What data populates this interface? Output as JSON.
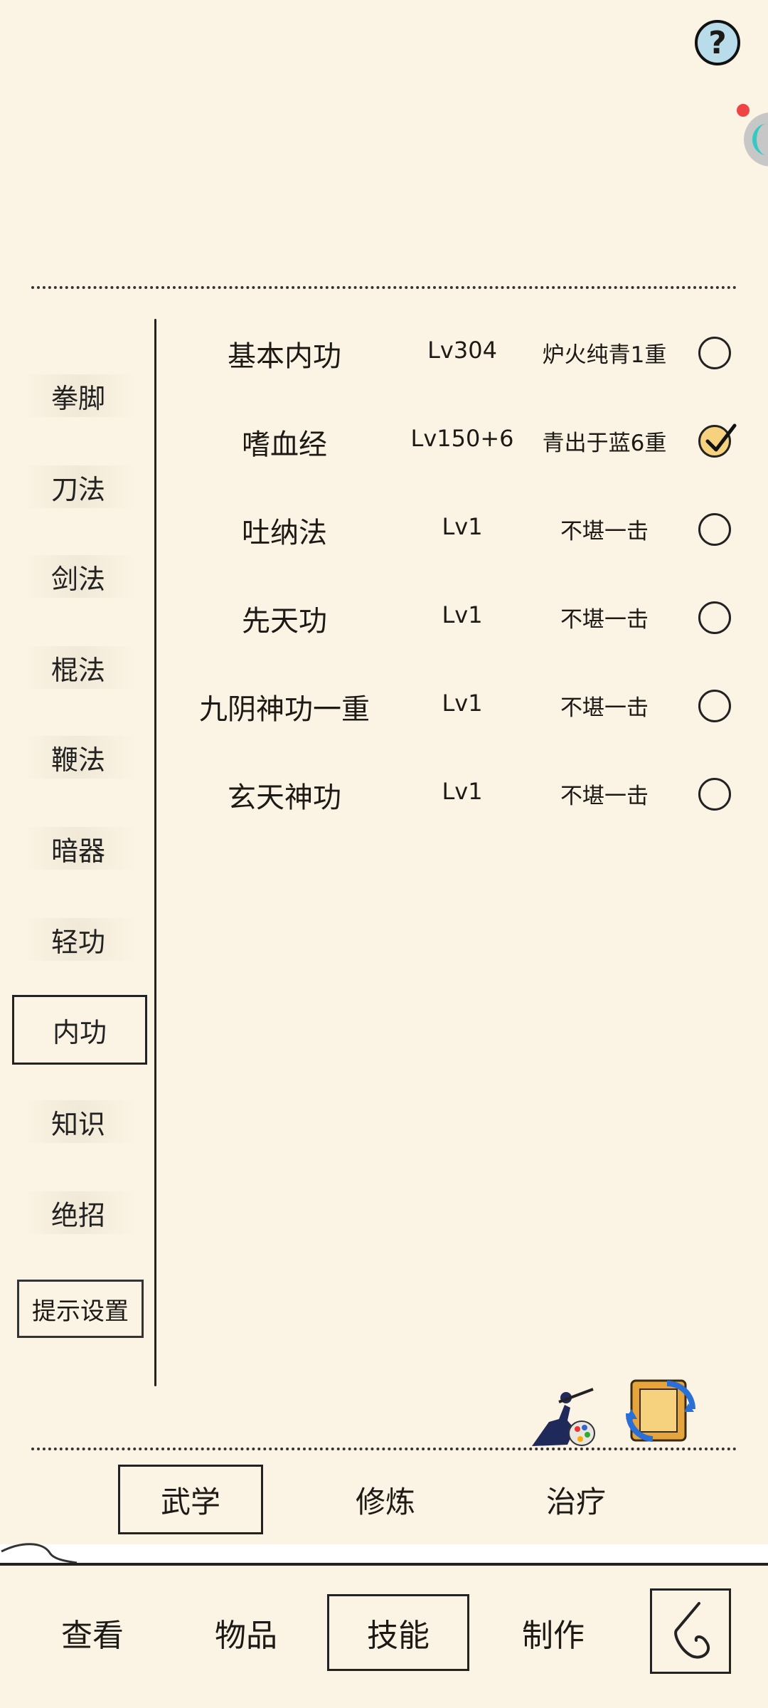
{
  "header": {
    "help_label": "?"
  },
  "sidebar": {
    "items": [
      {
        "label": "拳脚"
      },
      {
        "label": "刀法"
      },
      {
        "label": "剑法"
      },
      {
        "label": "棍法"
      },
      {
        "label": "鞭法"
      },
      {
        "label": "暗器"
      },
      {
        "label": "轻功"
      },
      {
        "label": "内功"
      },
      {
        "label": "知识"
      },
      {
        "label": "绝招"
      }
    ],
    "active": "内功",
    "hint_settings": "提示设置"
  },
  "skills": [
    {
      "name": "基本内功",
      "level": "Lv304",
      "rank": "炉火纯青1重",
      "selected": false
    },
    {
      "name": "嗜血经",
      "level": "Lv150+6",
      "rank": "青出于蓝6重",
      "selected": true
    },
    {
      "name": "吐纳法",
      "level": "Lv1",
      "rank": "不堪一击",
      "selected": false
    },
    {
      "name": "先天功",
      "level": "Lv1",
      "rank": "不堪一击",
      "selected": false
    },
    {
      "name": "九阴神功一重",
      "level": "Lv1",
      "rank": "不堪一击",
      "selected": false
    },
    {
      "name": "玄天神功",
      "level": "Lv1",
      "rank": "不堪一击",
      "selected": false
    }
  ],
  "subtabs": [
    {
      "label": "武学",
      "active": true
    },
    {
      "label": "修炼",
      "active": false
    },
    {
      "label": "治疗",
      "active": false
    }
  ],
  "bottom_nav": [
    {
      "label": "查看",
      "active": false
    },
    {
      "label": "物品",
      "active": false
    },
    {
      "label": "技能",
      "active": true
    },
    {
      "label": "制作",
      "active": false
    }
  ],
  "icons": {
    "help": "question-icon",
    "swordsman": "swordsman-skill-icon",
    "scroll": "scroll-exchange-icon",
    "back": "back-arrow-icon"
  },
  "colors": {
    "background": "#fbf4e4",
    "checked_radio": "#f6d27e",
    "help_button": "#b9dcea"
  }
}
